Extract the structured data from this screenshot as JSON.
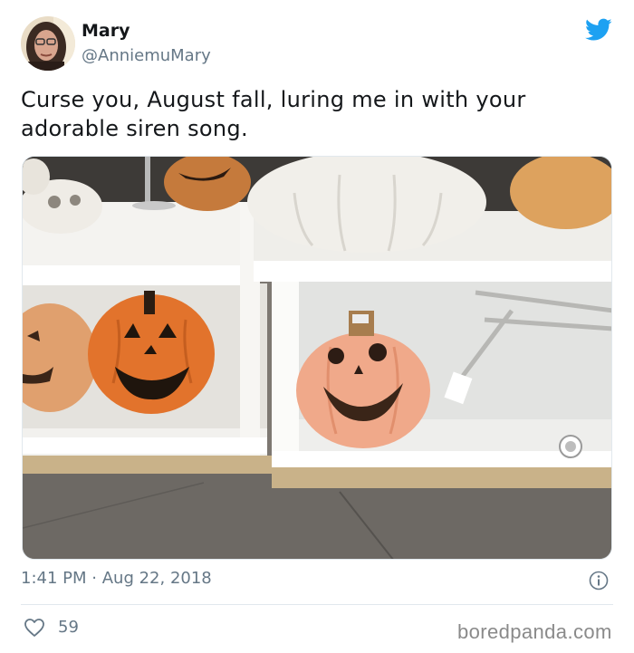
{
  "tweet": {
    "author_name": "Mary",
    "author_handle": "@AnniemuMary",
    "text": "Curse you, August fall, luring me in with your adorable siren song.",
    "time": "1:41 PM",
    "separator": "·",
    "date": "Aug 22, 2018",
    "like_count": "59"
  },
  "icons": {
    "brand": "twitter-bird-icon",
    "info": "info-icon",
    "like": "heart-icon"
  },
  "colors": {
    "twitter_blue": "#1da1f2",
    "secondary_text": "#657786",
    "primary_text": "#14171a"
  },
  "watermark": "boredpanda.com"
}
